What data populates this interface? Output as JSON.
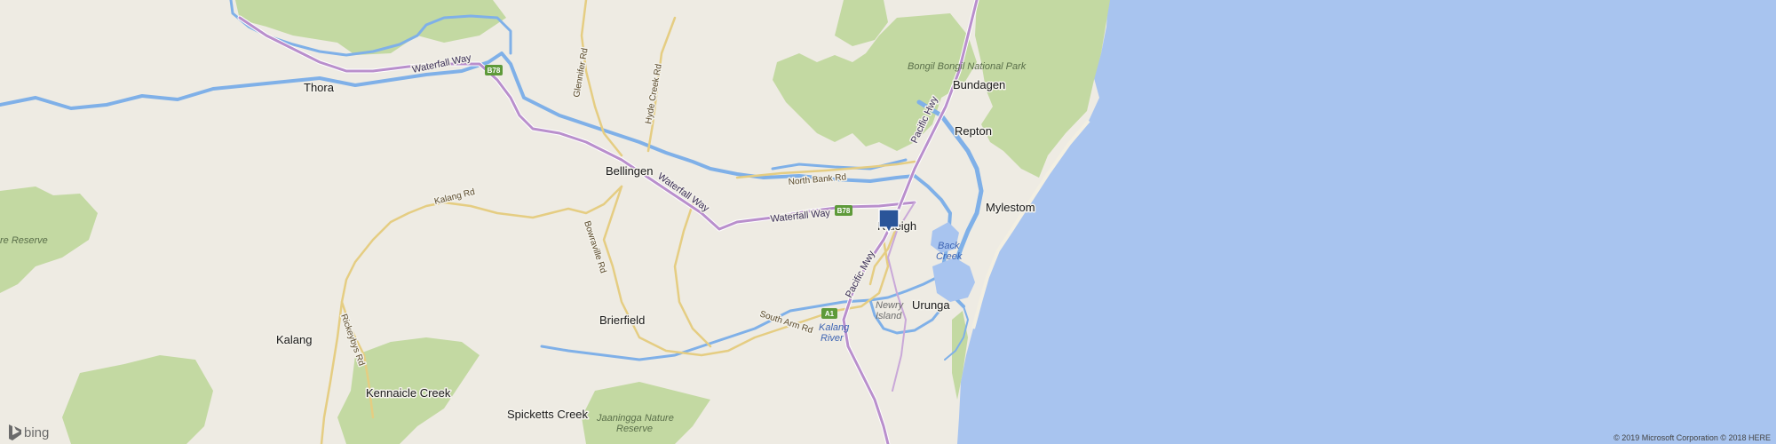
{
  "map": {
    "places": [
      {
        "label": "Thora"
      },
      {
        "label": "Bellingen"
      },
      {
        "label": "Bundagen"
      },
      {
        "label": "Repton"
      },
      {
        "label": "Mylestom"
      },
      {
        "label": "Raleigh"
      },
      {
        "label": "Urunga"
      },
      {
        "label": "Brierfield"
      },
      {
        "label": "Kalang"
      },
      {
        "label": "Kennaicle Creek"
      },
      {
        "label": "Spicketts Creek"
      }
    ],
    "parks": [
      {
        "label": "Bongil Bongil National Park"
      },
      {
        "label": "Jaaningga Nature"
      },
      {
        "label": "Reserve"
      },
      {
        "label": "re Reserve"
      }
    ],
    "roads": [
      {
        "label": "Waterfall Way"
      },
      {
        "label": "Waterfall Way"
      },
      {
        "label": "Waterfall Way"
      },
      {
        "label": "Pacific Hwy"
      },
      {
        "label": "Pacific Mwy"
      },
      {
        "label": "North Bank Rd"
      },
      {
        "label": "South Arm Rd"
      },
      {
        "label": "Kalang Rd"
      },
      {
        "label": "Bowraville Rd"
      },
      {
        "label": "Rickeybys Rd"
      },
      {
        "label": "Glennifer Rd"
      },
      {
        "label": "Hyde Creek Rd"
      }
    ],
    "shields": [
      {
        "label": "B78"
      },
      {
        "label": "B78"
      },
      {
        "label": "A1"
      }
    ],
    "water_labels": [
      {
        "label": "Back"
      },
      {
        "label": "Creek"
      },
      {
        "label": "Kalang"
      },
      {
        "label": "River"
      }
    ],
    "island_labels": [
      {
        "label": "Newry"
      },
      {
        "label": "Island"
      }
    ],
    "marker": {
      "icon": "location-pin-icon",
      "color": "#2a5599"
    }
  },
  "branding": {
    "logo_text": "bing"
  },
  "copyright": "© 2019 Microsoft Corporation © 2018 HERE",
  "colors": {
    "land": "#eeebe3",
    "ocean": "#a8c4ef",
    "river": "#7fb0e8",
    "park": "#c3d9a2",
    "highway": "#b98fcc",
    "road": "#e5cd82"
  }
}
